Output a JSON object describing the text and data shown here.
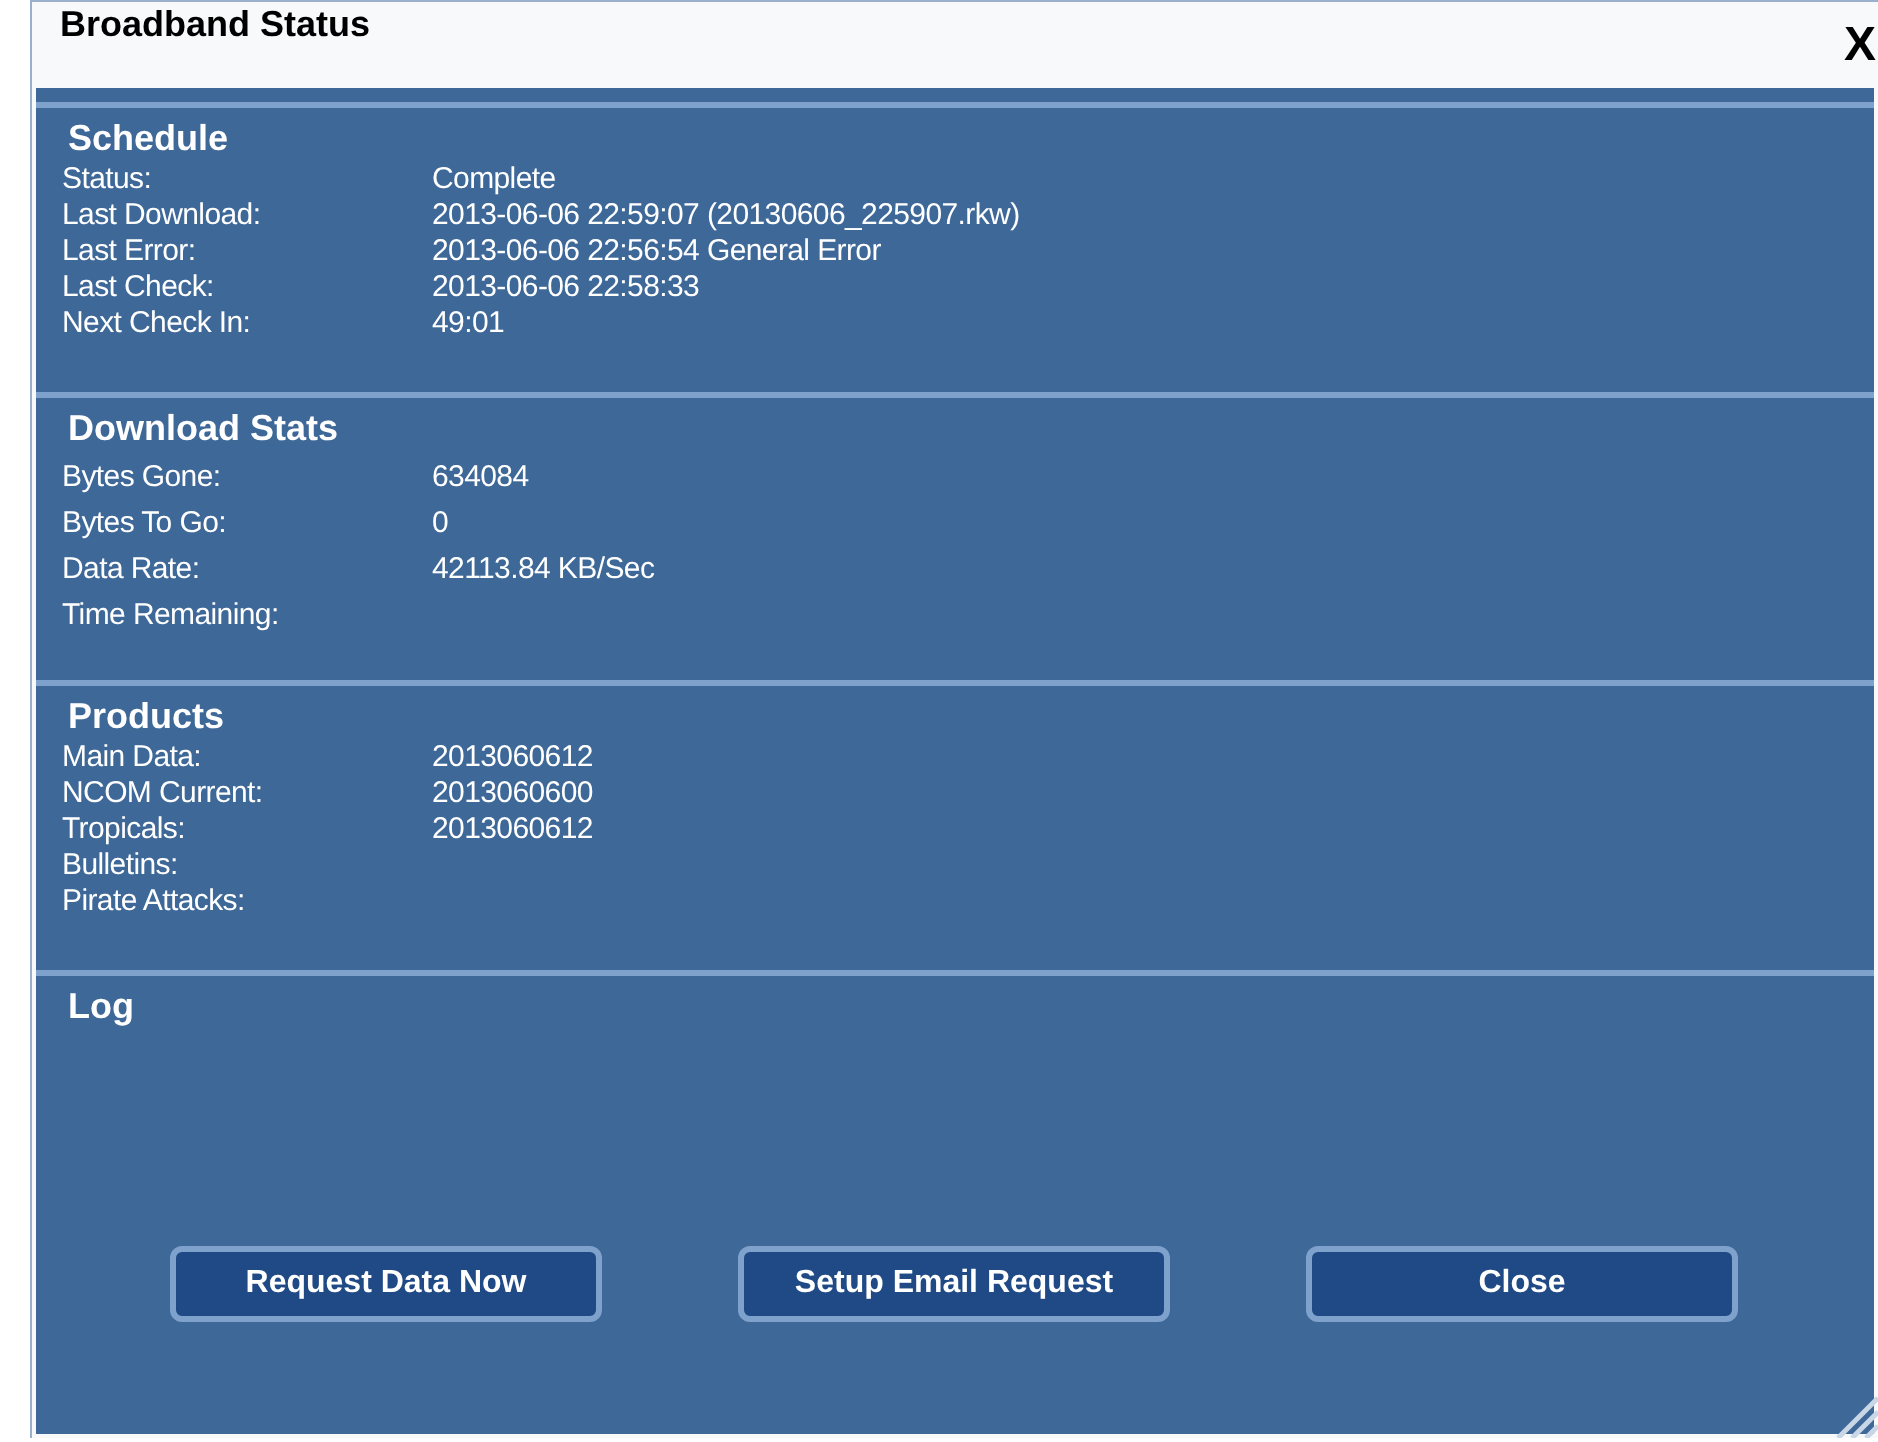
{
  "window": {
    "title": "Broadband Status",
    "close": "X"
  },
  "sections": [
    {
      "title": "Schedule",
      "kind": "tight",
      "rows": [
        {
          "label": "Status:",
          "value": "Complete"
        },
        {
          "label": "Last Download:",
          "value": "2013-06-06 22:59:07 (20130606_225907.rkw)"
        },
        {
          "label": "Last Error:",
          "value": "2013-06-06 22:56:54 General Error"
        },
        {
          "label": "Last Check:",
          "value": "2013-06-06 22:58:33"
        },
        {
          "label": "Next Check In:",
          "value": "49:01"
        }
      ]
    },
    {
      "title": "Download Stats",
      "kind": "spaced",
      "rows": [
        {
          "label": "Bytes Gone:",
          "value": "634084"
        },
        {
          "label": "Bytes To Go:",
          "value": "0"
        },
        {
          "label": "Data Rate:",
          "value": "42113.84 KB/Sec"
        },
        {
          "label": "Time Remaining:"
        }
      ]
    },
    {
      "title": "Products",
      "kind": "tight",
      "rows": [
        {
          "label": "Main Data:",
          "value": "2013060612"
        },
        {
          "label": "NCOM Current:",
          "value": "2013060600"
        },
        {
          "label": "Tropicals:",
          "value": "2013060612"
        },
        {
          "label": "Bulletins:"
        },
        {
          "label": "Pirate Attacks:"
        }
      ]
    },
    {
      "title": "Log",
      "kind": "log"
    }
  ],
  "buttons": [
    "Request Data Now",
    "Setup Email Request",
    "Close"
  ]
}
